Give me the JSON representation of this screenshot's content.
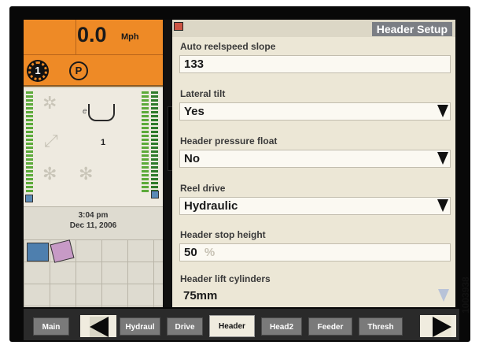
{
  "status": {
    "speed": "0.0",
    "speed_unit": "Mph",
    "gear": "1",
    "park": "P",
    "time": "3:04 pm",
    "date": "Dec 11, 2006",
    "gauge_count": "1"
  },
  "screen": {
    "title": "Header Setup"
  },
  "fields": [
    {
      "label": "Auto reelspeed slope",
      "value": "133",
      "unit": "",
      "type": "numeric"
    },
    {
      "label": "Lateral tilt",
      "value": "Yes",
      "unit": "",
      "type": "dropdown"
    },
    {
      "label": "Header pressure float",
      "value": "No",
      "unit": "",
      "type": "dropdown"
    },
    {
      "label": "Reel drive",
      "value": "Hydraulic",
      "unit": "",
      "type": "dropdown"
    },
    {
      "label": "Header stop height",
      "value": "50",
      "unit": "%",
      "type": "numeric"
    },
    {
      "label": "Header lift cylinders",
      "value": "75mm",
      "unit": "",
      "type": "dropdown-disabled"
    }
  ],
  "tabs": [
    {
      "label": "Main"
    },
    {
      "label": "Hydraul"
    },
    {
      "label": "Drive"
    },
    {
      "label": "Header",
      "active": true
    },
    {
      "label": "Head2"
    },
    {
      "label": "Feeder"
    },
    {
      "label": "Thresh"
    }
  ],
  "figure_id": "1003938",
  "colors": {
    "speed_panel": "#ee8a26",
    "title_bar": "#7b7e84",
    "gauge_bars": "#5caa3a"
  }
}
